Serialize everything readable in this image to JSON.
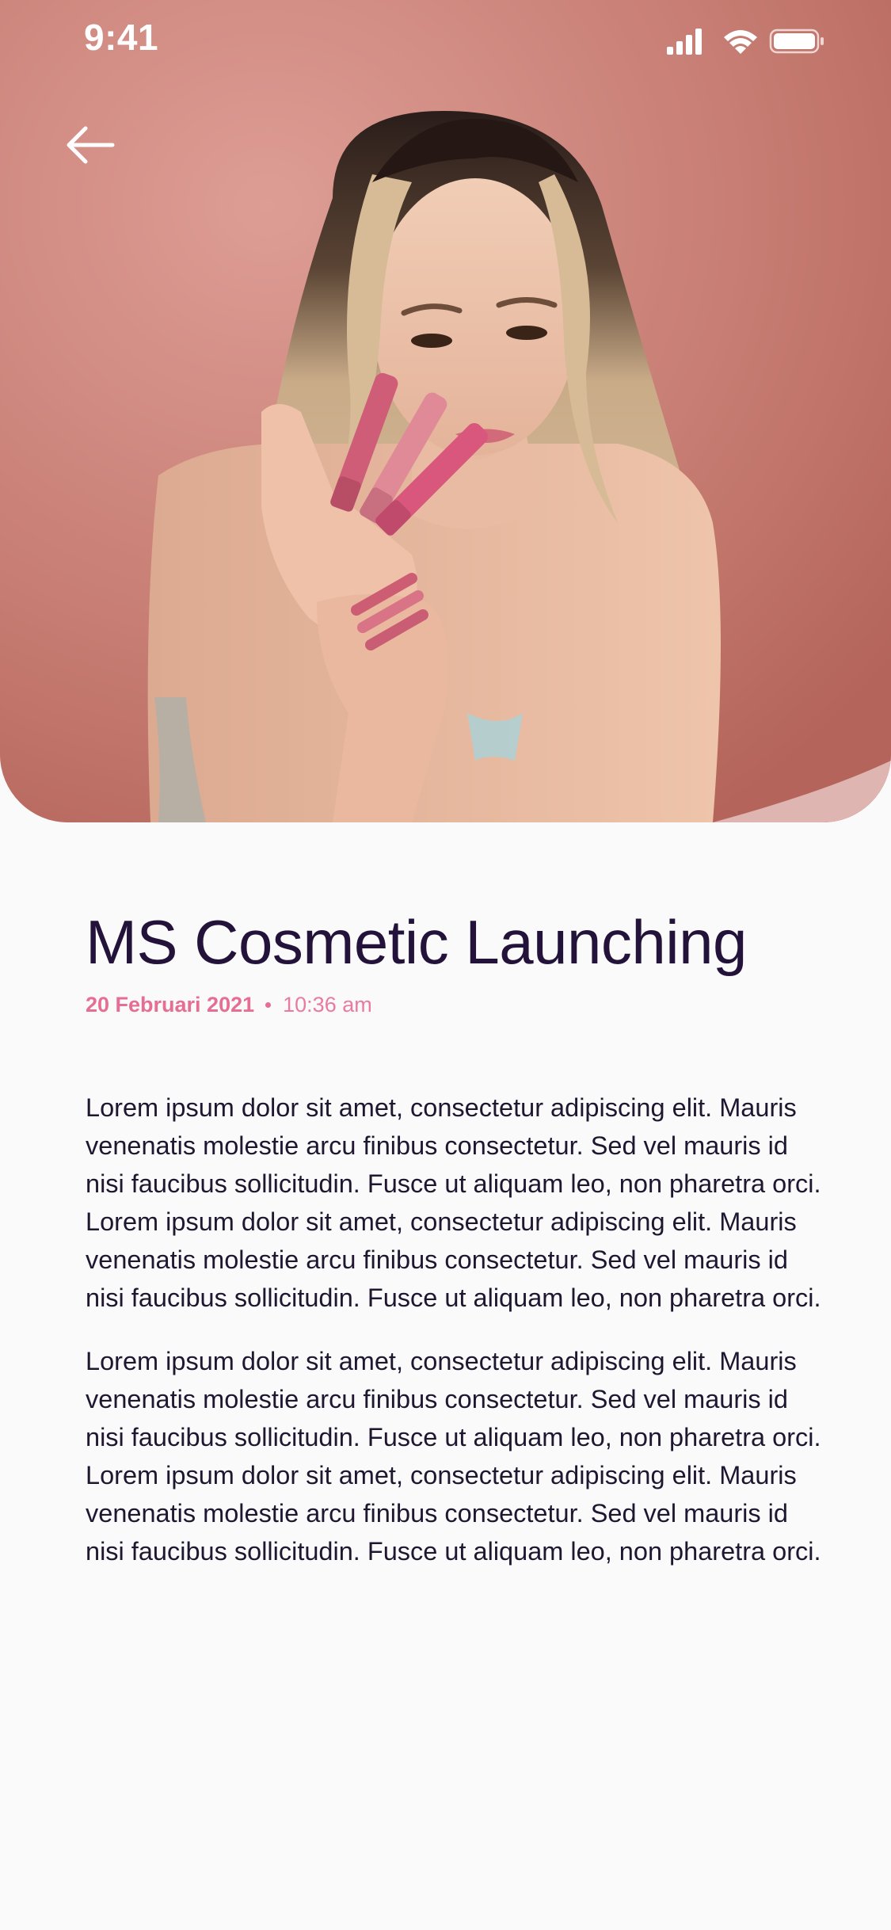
{
  "status_bar": {
    "time": "9:41",
    "icons": [
      "cellular-signal-icon",
      "wifi-icon",
      "battery-icon"
    ]
  },
  "hero": {
    "image_description_icon": "hero-photo",
    "back_icon": "arrow-left-icon"
  },
  "article": {
    "title": "MS Cosmetic Launching",
    "date": "20 Februari 2021",
    "time": "10:36 am",
    "paragraphs": [
      "Lorem ipsum dolor sit amet, consectetur adipiscing elit. Mauris venenatis molestie arcu finibus consectetur. Sed vel mauris id nisi faucibus sollicitudin. Fusce ut aliquam leo, non pharetra orci. Lorem ipsum dolor sit amet, consectetur adipiscing elit. Mauris venenatis molestie arcu finibus consectetur. Sed vel mauris id nisi faucibus sollicitudin. Fusce ut aliquam leo, non pharetra orci.",
      "Lorem ipsum dolor sit amet, consectetur adipiscing elit. Mauris venenatis molestie arcu finibus consectetur. Sed vel mauris id nisi faucibus sollicitudin. Fusce ut aliquam leo, non pharetra orci. Lorem ipsum dolor sit amet, consectetur adipiscing elit. Mauris venenatis molestie arcu finibus consectetur. Sed vel mauris id nisi faucibus sollicitudin. Fusce ut aliquam leo, non pharetra orci."
    ]
  },
  "colors": {
    "hero_background": "#c98077",
    "title": "#23133a",
    "accent_pink": "#e66d93",
    "body_text": "#1f1630",
    "page_background": "#fafafa"
  }
}
